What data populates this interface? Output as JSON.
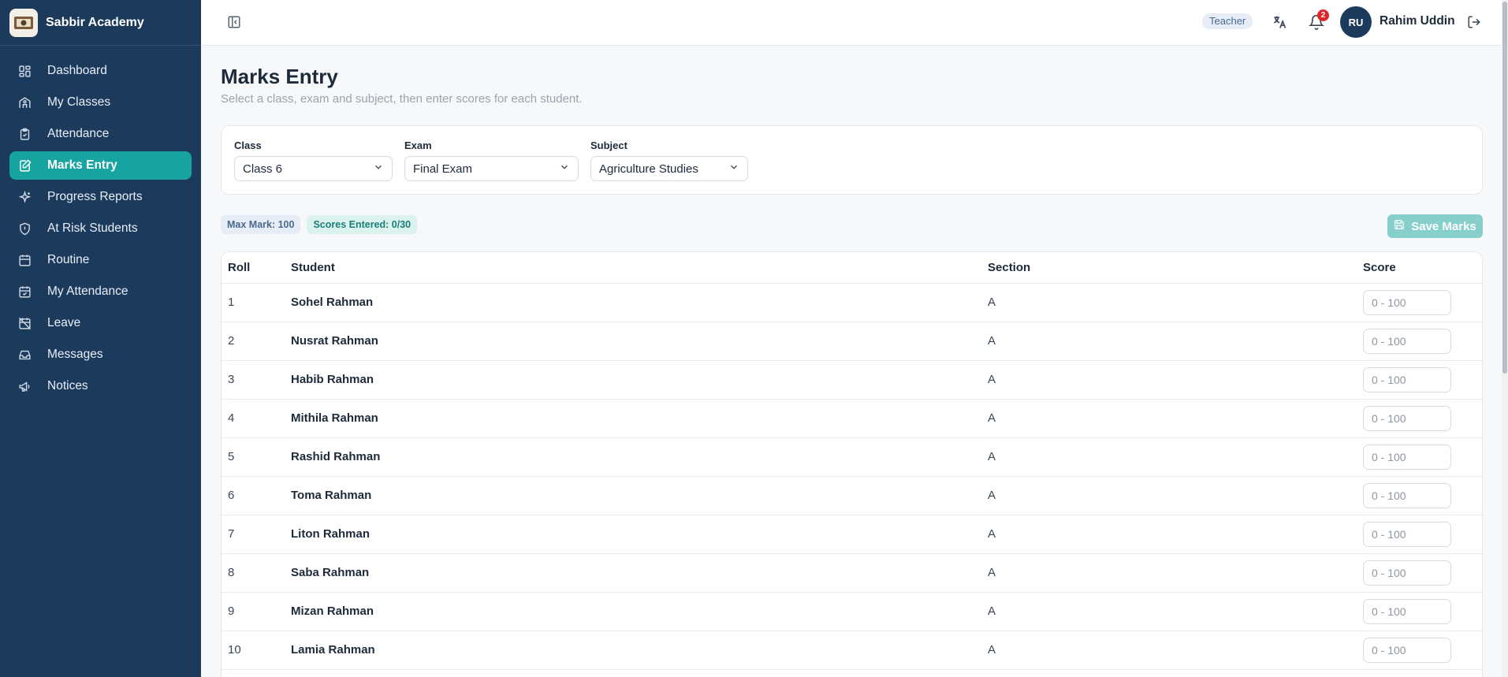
{
  "app": {
    "name": "Sabbir Academy"
  },
  "sidebar": {
    "items": [
      {
        "label": "Dashboard",
        "icon": "dashboard-icon"
      },
      {
        "label": "My Classes",
        "icon": "classes-icon"
      },
      {
        "label": "Attendance",
        "icon": "clipboard-check-icon"
      },
      {
        "label": "Marks Entry",
        "icon": "edit-document-icon",
        "active": true
      },
      {
        "label": "Progress Reports",
        "icon": "sparkles-icon"
      },
      {
        "label": "At Risk Students",
        "icon": "shield-alert-icon"
      },
      {
        "label": "Routine",
        "icon": "calendar-icon"
      },
      {
        "label": "My Attendance",
        "icon": "calendar-check-icon"
      },
      {
        "label": "Leave",
        "icon": "calendar-off-icon"
      },
      {
        "label": "Messages",
        "icon": "inbox-icon"
      },
      {
        "label": "Notices",
        "icon": "megaphone-icon"
      }
    ]
  },
  "header": {
    "role": "Teacher",
    "notifications_count": "2",
    "user_initials": "RU",
    "user_name": "Rahim Uddin"
  },
  "page": {
    "title": "Marks Entry",
    "subtitle": "Select a class, exam and subject, then enter scores for each student."
  },
  "filters": {
    "class": {
      "label": "Class",
      "value": "Class 6"
    },
    "exam": {
      "label": "Exam",
      "value": "Final Exam"
    },
    "subject": {
      "label": "Subject",
      "value": "Agriculture Studies"
    }
  },
  "summary": {
    "max_mark": "Max Mark: 100",
    "scores_entered": "Scores Entered: 0/30",
    "save_label": "Save Marks"
  },
  "table": {
    "headers": {
      "roll": "Roll",
      "student": "Student",
      "section": "Section",
      "score": "Score"
    },
    "score_placeholder": "0 - 100",
    "rows": [
      {
        "roll": "1",
        "student": "Sohel Rahman",
        "section": "A"
      },
      {
        "roll": "2",
        "student": "Nusrat Rahman",
        "section": "A"
      },
      {
        "roll": "3",
        "student": "Habib Rahman",
        "section": "A"
      },
      {
        "roll": "4",
        "student": "Mithila Rahman",
        "section": "A"
      },
      {
        "roll": "5",
        "student": "Rashid Rahman",
        "section": "A"
      },
      {
        "roll": "6",
        "student": "Toma Rahman",
        "section": "A"
      },
      {
        "roll": "7",
        "student": "Liton Rahman",
        "section": "A"
      },
      {
        "roll": "8",
        "student": "Saba Rahman",
        "section": "A"
      },
      {
        "roll": "9",
        "student": "Mizan Rahman",
        "section": "A"
      },
      {
        "roll": "10",
        "student": "Lamia Rahman",
        "section": "A"
      }
    ]
  },
  "colors": {
    "sidebar_bg": "#1c3a5c",
    "accent": "#17a3a0",
    "notification": "#e0262d"
  }
}
